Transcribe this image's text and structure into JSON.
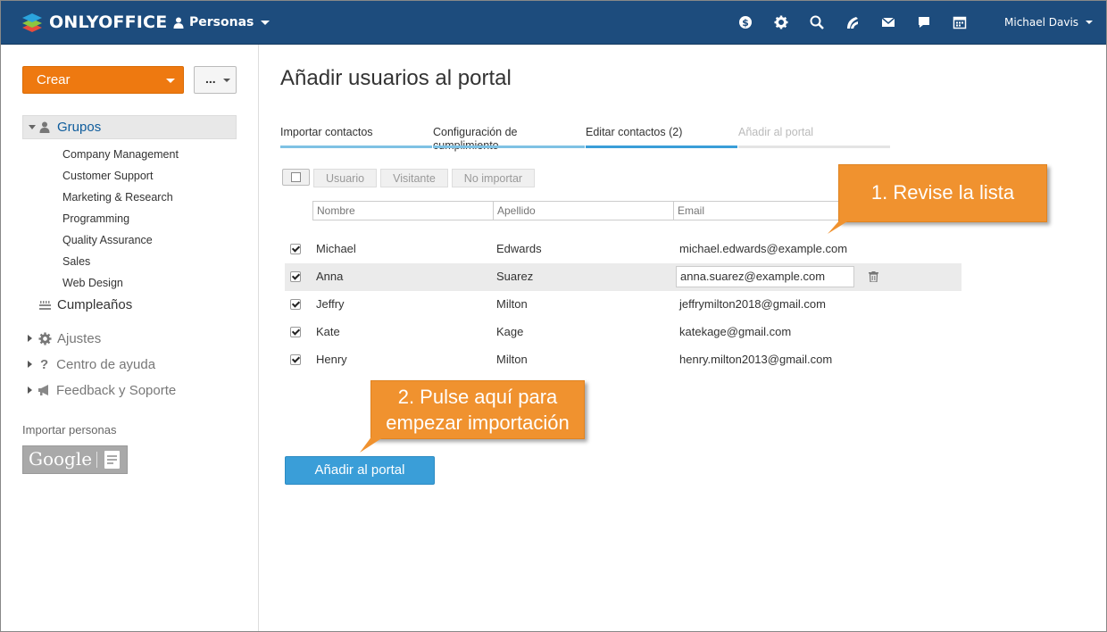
{
  "topbar": {
    "logo_text": "ONLYOFFICE",
    "module": "Personas",
    "user_name": "Michael Davis",
    "icons": [
      "currency-icon",
      "settings-gear-icon",
      "search-icon",
      "feed-icon",
      "mail-icon",
      "chat-icon",
      "calendar-icon"
    ],
    "background_color": "#1d4c7d"
  },
  "sidebar": {
    "create_label": "Crear",
    "more_label": "...",
    "groups_label": "Grupos",
    "groups": [
      "Company Management",
      "Customer Support",
      "Marketing & Research",
      "Programming",
      "Quality Assurance",
      "Sales",
      "Web Design"
    ],
    "birthdays_label": "Cumpleaños",
    "settings_label": "Ajustes",
    "help_label": "Centro de ayuda",
    "feedback_label": "Feedback y Soporte",
    "import_label": "Importar personas",
    "google_label": "Google"
  },
  "main": {
    "title": "Añadir usuarios al portal",
    "steps": [
      {
        "label": "Importar contactos",
        "state": "done"
      },
      {
        "label": "Configuración de cumplimiento",
        "state": "done"
      },
      {
        "label": "Editar contactos (2)",
        "state": "current"
      },
      {
        "label": "Añadir al portal",
        "state": "future"
      }
    ],
    "toolbar": {
      "user_label": "Usuario",
      "visitor_label": "Visitante",
      "noimport_label": "No importar"
    },
    "filters": {
      "first_name": "Nombre",
      "last_name": "Apellido",
      "email": "Email"
    },
    "rows": [
      {
        "first": "Michael",
        "last": "Edwards",
        "email": "michael.edwards@example.com",
        "checked": true
      },
      {
        "first": "Anna",
        "last": "Suarez",
        "email": "anna.suarez@example.com",
        "checked": true,
        "editing": true
      },
      {
        "first": "Jeffry",
        "last": "Milton",
        "email": "jeffrymilton2018@gmail.com",
        "checked": true
      },
      {
        "first": "Kate",
        "last": "Kage",
        "email": "katekage@gmail.com",
        "checked": true
      },
      {
        "first": "Henry",
        "last": "Milton",
        "email": "henry.milton2013@gmail.com",
        "checked": true
      }
    ],
    "add_button": "Añadir al portal"
  },
  "callouts": {
    "review": "1. Revise la lista",
    "click_line1": "2. Pulse aquí para",
    "click_line2": "empezar importación",
    "color": "#f0922f"
  }
}
